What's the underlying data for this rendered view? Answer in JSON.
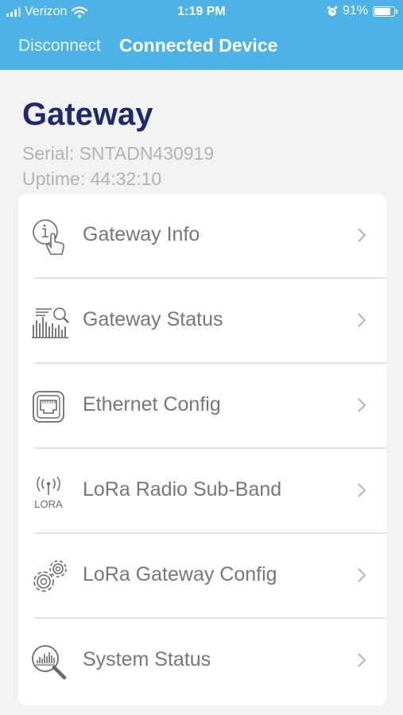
{
  "status_bar": {
    "carrier": "Verizon",
    "time": "1:19 PM",
    "battery": "91%",
    "battery_level": 0.91
  },
  "nav": {
    "disconnect_label": "Disconnect",
    "title": "Connected Device"
  },
  "device": {
    "title": "Gateway",
    "serial": "Serial:  SNTADN430919",
    "uptime": "Uptime: 44:32:10"
  },
  "menu": {
    "items": [
      {
        "label": "Gateway Info",
        "icon": "info-touch-icon"
      },
      {
        "label": "Gateway Status",
        "icon": "status-chart-icon"
      },
      {
        "label": "Ethernet Config",
        "icon": "ethernet-port-icon"
      },
      {
        "label": "LoRa Radio Sub-Band",
        "icon": "lora-antenna-icon"
      },
      {
        "label": "LoRa Gateway Config",
        "icon": "gears-icon"
      },
      {
        "label": "System Status",
        "icon": "magnify-chart-icon"
      }
    ],
    "lora_icon_text": "LORA"
  },
  "colors": {
    "header_bg": "#4db3e6",
    "title": "#1d2a6e",
    "label": "#777777",
    "meta": "#b3b3b3"
  }
}
